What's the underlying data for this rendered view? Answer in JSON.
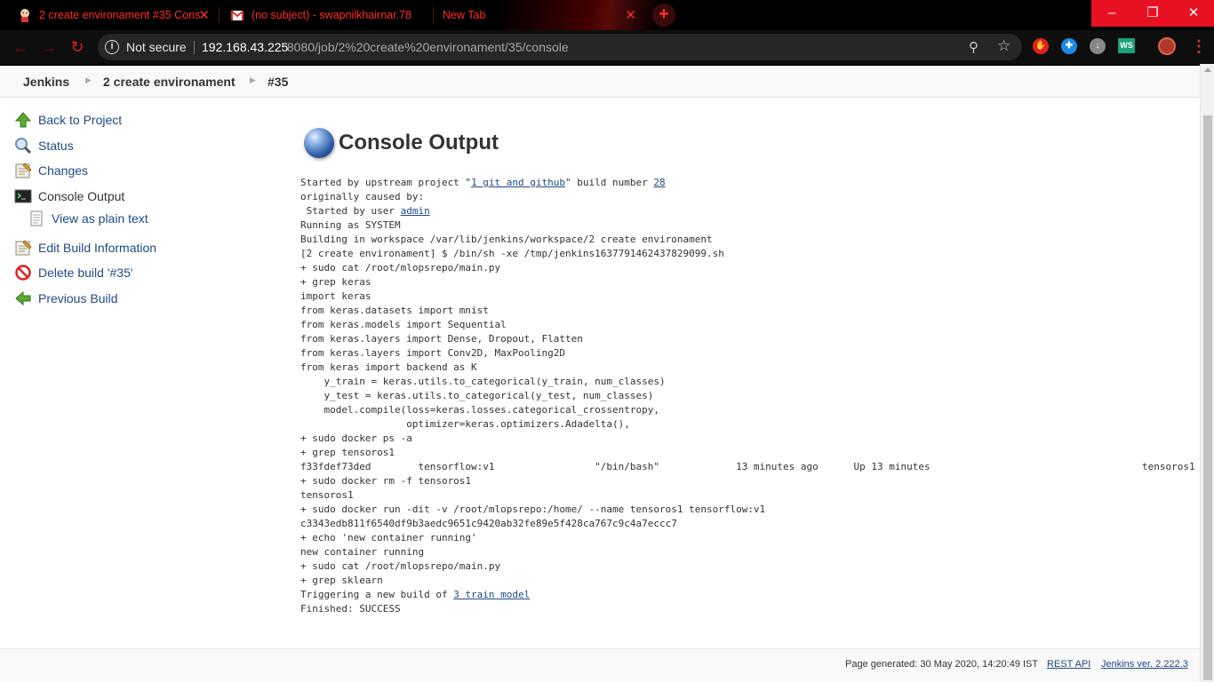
{
  "browser": {
    "tabs": [
      {
        "title": "2 create environament #35 Cons",
        "favicon": "jenkins-butler-icon"
      },
      {
        "title": "(no subject) - swapnilkhairnar.78",
        "favicon": "gmail-icon"
      },
      {
        "title": "New Tab",
        "favicon": ""
      }
    ],
    "new_tab_symbol": "+",
    "window_controls": [
      "–",
      "❐",
      "✕"
    ],
    "nav": {
      "back": "←",
      "forward": "→",
      "reload": "↻"
    },
    "address": {
      "security_label": "Not secure",
      "host": "192.168.43.225",
      "rest": ":8080/job/2%20create%20environament/35/console"
    },
    "extensions": [
      {
        "name": "adblock-icon",
        "color": "#e02020",
        "glyph": "✋"
      },
      {
        "name": "extension-blue-icon",
        "color": "#1e88e5",
        "glyph": "✚"
      },
      {
        "name": "download-icon",
        "color": "#888888",
        "glyph": "↓"
      }
    ],
    "ws_label": "WS",
    "menu_glyph": "⋮",
    "accent": "#ff2a2a"
  },
  "breadcrumbs": [
    "Jenkins",
    "2 create environament",
    "#35"
  ],
  "sidebar": {
    "items": [
      {
        "label": "Back to Project",
        "icon": "up-arrow-icon"
      },
      {
        "label": "Status",
        "icon": "magnifier-icon"
      },
      {
        "label": "Changes",
        "icon": "notepad-icon"
      },
      {
        "label": "Console Output",
        "icon": "terminal-icon"
      },
      {
        "label": "View as plain text",
        "icon": "document-icon"
      },
      {
        "label": "Edit Build Information",
        "icon": "notepad-icon"
      },
      {
        "label": "Delete build '#35'",
        "icon": "no-entry-icon"
      },
      {
        "label": "Previous Build",
        "icon": "left-arrow-icon"
      }
    ]
  },
  "main": {
    "title": "Console Output",
    "console": [
      [
        {
          "t": "Started by upstream project \""
        },
        {
          "t": "1 git and github",
          "link": true
        },
        {
          "t": "\" build number "
        },
        {
          "t": "28",
          "link": true
        }
      ],
      [
        {
          "t": "originally caused by:"
        }
      ],
      [
        {
          "t": " Started by user "
        },
        {
          "t": "admin",
          "link": true
        }
      ],
      [
        {
          "t": "Running as SYSTEM"
        }
      ],
      [
        {
          "t": "Building in workspace /var/lib/jenkins/workspace/2 create environament"
        }
      ],
      [
        {
          "t": "[2 create environament] $ /bin/sh -xe /tmp/jenkins1637791462437829099.sh"
        }
      ],
      [
        {
          "t": "+ sudo cat /root/mlopsrepo/main.py"
        }
      ],
      [
        {
          "t": "+ grep keras"
        }
      ],
      [
        {
          "t": "import keras"
        }
      ],
      [
        {
          "t": "from keras.datasets import mnist"
        }
      ],
      [
        {
          "t": "from keras.models import Sequential"
        }
      ],
      [
        {
          "t": "from keras.layers import Dense, Dropout, Flatten"
        }
      ],
      [
        {
          "t": "from keras.layers import Conv2D, MaxPooling2D"
        }
      ],
      [
        {
          "t": "from keras import backend as K"
        }
      ],
      [
        {
          "t": "    y_train = keras.utils.to_categorical(y_train, num_classes)"
        }
      ],
      [
        {
          "t": "    y_test = keras.utils.to_categorical(y_test, num_classes)"
        }
      ],
      [
        {
          "t": "    model.compile(loss=keras.losses.categorical_crossentropy,"
        }
      ],
      [
        {
          "t": "                  optimizer=keras.optimizers.Adadelta(),"
        }
      ],
      [
        {
          "t": "+ sudo docker ps -a"
        }
      ],
      [
        {
          "t": "+ grep tensoros1"
        }
      ],
      [
        {
          "t": "f33fdef73ded        tensorflow:v1                 \"/bin/bash\"             13 minutes ago      Up 13 minutes                                    tensoros1"
        }
      ],
      [
        {
          "t": "+ sudo docker rm -f tensoros1"
        }
      ],
      [
        {
          "t": "tensoros1"
        }
      ],
      [
        {
          "t": "+ sudo docker run -dit -v /root/mlopsrepo:/home/ --name tensoros1 tensorflow:v1"
        }
      ],
      [
        {
          "t": "c3343edb811f6540df9b3aedc9651c9420ab32fe89e5f428ca767c9c4a7eccc7"
        }
      ],
      [
        {
          "t": "+ echo 'new container running'"
        }
      ],
      [
        {
          "t": "new container running"
        }
      ],
      [
        {
          "t": "+ sudo cat /root/mlopsrepo/main.py"
        }
      ],
      [
        {
          "t": "+ grep sklearn"
        }
      ],
      [
        {
          "t": "Triggering a new build of "
        },
        {
          "t": "3 train model",
          "link": true
        }
      ],
      [
        {
          "t": "Finished: SUCCESS"
        }
      ]
    ]
  },
  "footer": {
    "generated": "Page generated: 30 May 2020, 14:20:49 IST",
    "rest_api": "REST API",
    "version": "Jenkins ver. 2.222.3"
  }
}
